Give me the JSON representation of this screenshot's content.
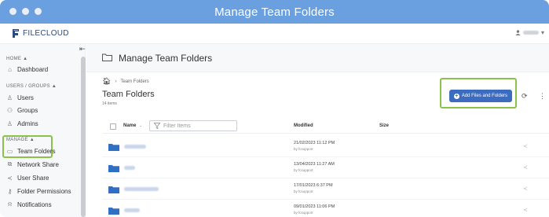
{
  "window": {
    "title": "Manage Team Folders"
  },
  "app": {
    "brand": "FILECLOUD",
    "user_caret": "▾"
  },
  "sidebar": {
    "collapse_icon": "collapse-sidebar-icon",
    "sections": {
      "home": "HOME ▲",
      "users_groups": "USERS / GROUPS ▲",
      "manage": "MANAGE ▲"
    },
    "items": [
      {
        "label": "Dashboard",
        "icon": "home-icon"
      },
      {
        "label": "Users",
        "icon": "user-icon"
      },
      {
        "label": "Groups",
        "icon": "group-icon"
      },
      {
        "label": "Admins",
        "icon": "admin-icon"
      },
      {
        "label": "Team Folders",
        "icon": "folder-icon"
      },
      {
        "label": "Network Share",
        "icon": "network-icon"
      },
      {
        "label": "User Share",
        "icon": "share-icon"
      },
      {
        "label": "Folder Permissions",
        "icon": "permission-icon"
      },
      {
        "label": "Notifications",
        "icon": "bell-icon"
      }
    ]
  },
  "page": {
    "header_title": "Manage Team Folders",
    "breadcrumb": "Team Folders",
    "title": "Team Folders",
    "count": "14 items",
    "add_button": "Add Files and Folders"
  },
  "table": {
    "columns": {
      "name": "Name",
      "sort": "⌄",
      "modified": "Modified",
      "size": "Size"
    },
    "filter_placeholder": "Filter Items",
    "rows": [
      {
        "modified": "21/02/2023 11:12 PM",
        "by": "by fcsupport"
      },
      {
        "modified": "13/04/2023 11:27 AM",
        "by": "by fcsupport"
      },
      {
        "modified": "17/01/2023 6:37 PM",
        "by": "by fcsupport"
      },
      {
        "modified": "09/01/2023 11:06 PM",
        "by": "by fcsupport"
      }
    ]
  },
  "colors": {
    "titlebar": "#6a9fe0",
    "accent": "#3b6cc0",
    "highlight": "#8bc34a",
    "folder": "#2f6fc4"
  }
}
